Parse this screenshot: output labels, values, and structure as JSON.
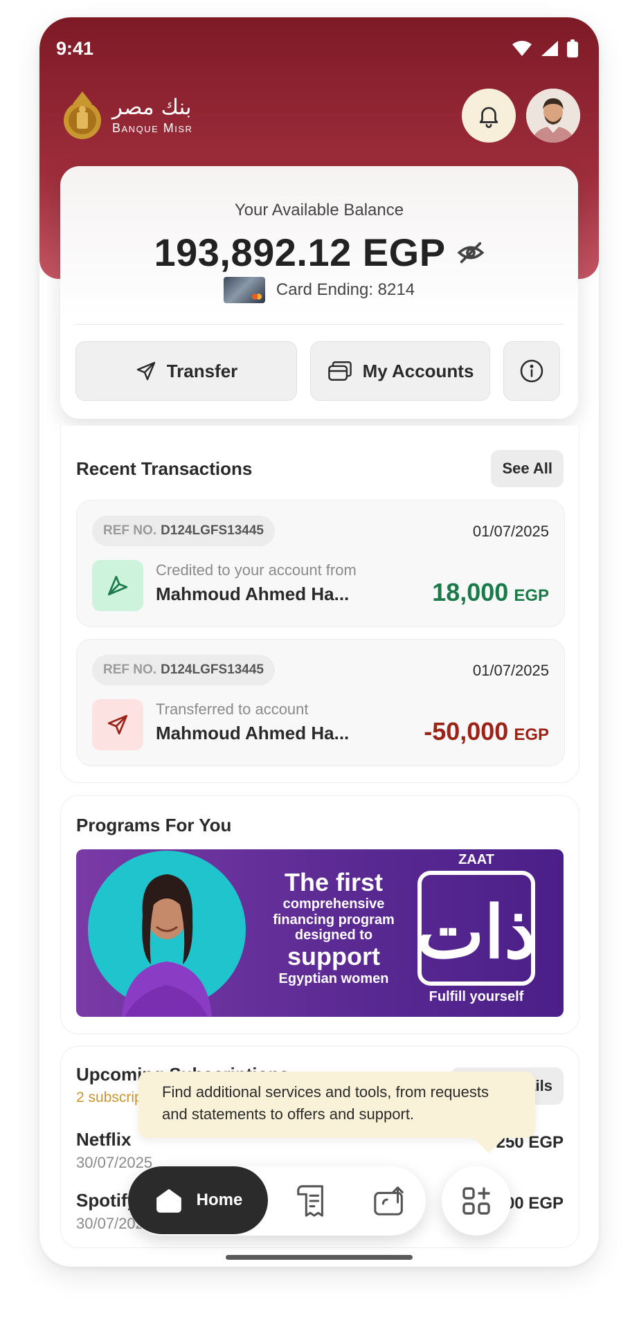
{
  "status": {
    "time": "9:41"
  },
  "brand": {
    "name_ar": "بنك مصر",
    "name_en": "Banque Misr"
  },
  "balance": {
    "label": "Your Available Balance",
    "amount": "193,892.12 EGP",
    "card_ending": "Card Ending: 8214"
  },
  "actions": {
    "transfer": "Transfer",
    "accounts": "My Accounts"
  },
  "transactions": {
    "title": "Recent Transactions",
    "see_all": "See All",
    "items": [
      {
        "ref_label": "REF NO.",
        "ref": "D124LGFS13445",
        "date": "01/07/2025",
        "desc": "Credited to your account from",
        "name": "Mahmoud Ahmed Ha...",
        "amount": "18,000",
        "currency": "EGP",
        "amount_color": "#1a7a4a"
      },
      {
        "ref_label": "REF NO.",
        "ref": "D124LGFS13445",
        "date": "01/07/2025",
        "desc": "Transferred to account",
        "name": "Mahmoud Ahmed Ha...",
        "amount": "-50,000",
        "currency": "EGP",
        "amount_color": "#9b2318"
      }
    ]
  },
  "programs": {
    "title": "Programs For You",
    "banner": {
      "brand": "ZAAT",
      "logo_ar": "ذات",
      "headline_1": "The first",
      "headline_2": "comprehensive",
      "headline_3": "financing program",
      "headline_4": "designed to",
      "headline_5": "support",
      "headline_6": "Egyptian women",
      "tagline": "Fulfill yourself"
    }
  },
  "subscriptions": {
    "title": "Upcoming Subscriptions",
    "count_text": "2 subscriptions",
    "more_details": "More Details",
    "items": [
      {
        "name": "Netflix",
        "date": "30/07/2025",
        "amount": "250 EGP"
      },
      {
        "name": "Spotify",
        "date": "30/07/2025",
        "amount": "100 EGP"
      }
    ]
  },
  "tooltip": {
    "text": "Find additional services and tools, from requests and statements to offers and support."
  },
  "nav": {
    "home": "Home"
  },
  "colors": {
    "brand_maroon": "#7d1a26",
    "credit_green": "#1a7a4a",
    "debit_red": "#9b2318",
    "gold": "#c9972f"
  },
  "icons": [
    "wifi-icon",
    "signal-icon",
    "battery-icon",
    "bell-icon",
    "eye-off-icon",
    "send-icon",
    "wallet-icon",
    "info-icon",
    "receipt-icon",
    "transfer-icon",
    "apps-add-icon",
    "home-icon"
  ]
}
